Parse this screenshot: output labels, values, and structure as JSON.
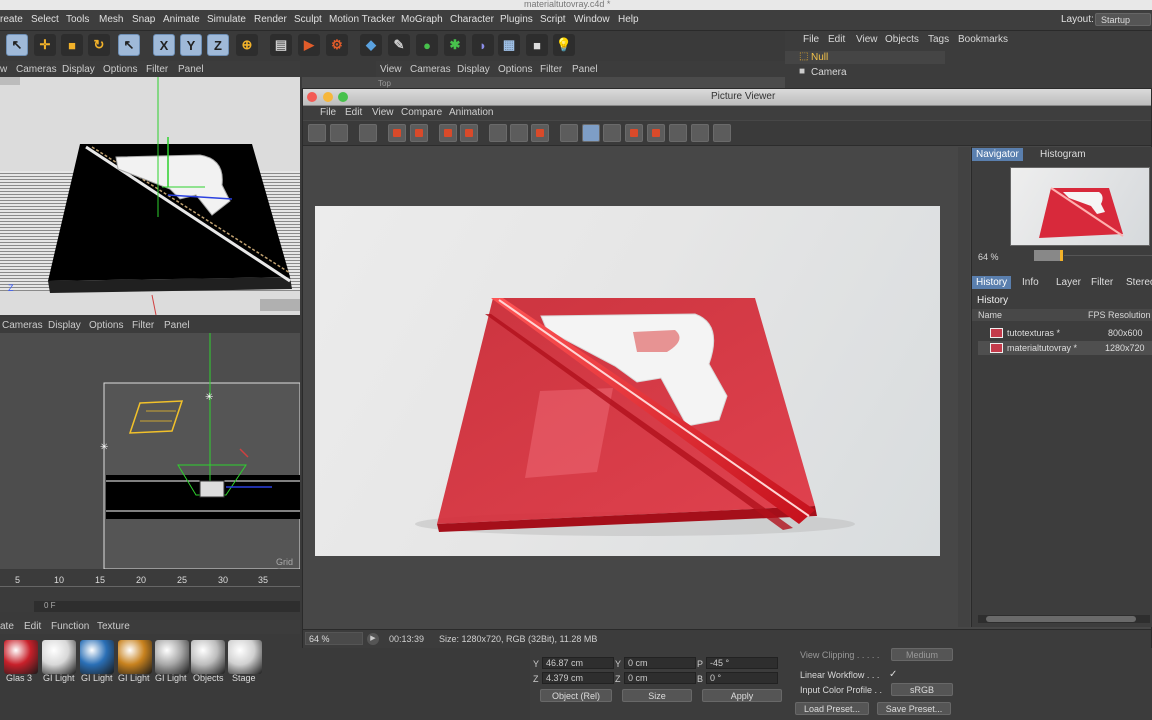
{
  "window": {
    "title": "materialtutovray.c4d *"
  },
  "menubar": {
    "items": [
      "reate",
      "Select",
      "Tools",
      "Mesh",
      "Snap",
      "Animate",
      "Simulate",
      "Render",
      "Sculpt",
      "Motion Tracker",
      "MoGraph",
      "Character",
      "Plugins",
      "Script",
      "Window",
      "Help"
    ],
    "layout_label": "Layout:",
    "layout_value": "Startup"
  },
  "viewport_top_left": {
    "menu": [
      "w",
      "Cameras",
      "Display",
      "Options",
      "Filter",
      "Panel"
    ],
    "axis_label": "Z"
  },
  "viewport_top_right": {
    "menu": [
      "View",
      "Cameras",
      "Display",
      "Options",
      "Filter",
      "Panel"
    ],
    "sublabel": "Top"
  },
  "viewport_bottom_left": {
    "menu": [
      "Cameras",
      "Display",
      "Options",
      "Filter",
      "Panel"
    ],
    "grid_label": "Grid S"
  },
  "object_manager": {
    "menu": [
      "File",
      "Edit",
      "View",
      "Objects",
      "Tags",
      "Bookmarks"
    ],
    "objects": [
      "Null",
      "Camera"
    ]
  },
  "picture_viewer": {
    "title": "Picture Viewer",
    "menu": [
      "File",
      "Edit",
      "View",
      "Compare",
      "Animation"
    ],
    "side_tabs_top": [
      "Navigator",
      "Histogram"
    ],
    "zoom": "64 %",
    "side_tabs_bottom": [
      "History",
      "Info",
      "Layer",
      "Filter",
      "Stereo"
    ],
    "history": {
      "title": "History",
      "columns": [
        "Name",
        "FPS",
        "Resolution"
      ],
      "rows": [
        {
          "name": "tutotexturas *",
          "resolution": "800x600"
        },
        {
          "name": "materialtutovray *",
          "resolution": "1280x720"
        }
      ]
    },
    "status": {
      "zoom": "64 %",
      "time": "00:13:39",
      "info": "Size: 1280x720, RGB (32Bit), 11.28 MB"
    }
  },
  "timeline": {
    "ticks": [
      "5",
      "10",
      "15",
      "20",
      "25",
      "30",
      "35"
    ],
    "frame": "0 F"
  },
  "material_manager": {
    "menu": [
      "ate",
      "Edit",
      "Function",
      "Texture"
    ],
    "materials": [
      {
        "label": "Glas 3",
        "color": "#c8202a"
      },
      {
        "label": "GI Light",
        "color": "#d8d8d8"
      },
      {
        "label": "GI Light",
        "color": "#2a6fb6"
      },
      {
        "label": "GI Light",
        "color": "#c8821e"
      },
      {
        "label": "GI Light",
        "color": "#a8a8a8"
      },
      {
        "label": "Objects",
        "color": "#bdbdbd"
      },
      {
        "label": "Stage",
        "color": "#d0d0d0"
      }
    ]
  },
  "coordinates": {
    "y_pos": "46.87 cm",
    "y_size": "0 cm",
    "p_rot": "-45 °",
    "z_pos": "4.379 cm",
    "z_size": "0 cm",
    "b_rot": "0 °",
    "labels": [
      "Y",
      "Y",
      "P",
      "Z",
      "Z",
      "B"
    ],
    "mode": "Object (Rel)",
    "size_mode": "Size",
    "apply": "Apply"
  },
  "attributes": {
    "view_clipping_label": "View Clipping . . . . .",
    "view_clipping_value": "Medium",
    "linear_workflow_label": "Linear Workflow . . .",
    "linear_workflow_check": "✓",
    "input_color_label": "Input Color Profile . .",
    "input_color_value": "sRGB",
    "load_preset": "Load Preset...",
    "save_preset": "Save Preset..."
  },
  "colors": {
    "accent_blue": "#5a7fae",
    "render_red": "#d8293b"
  }
}
